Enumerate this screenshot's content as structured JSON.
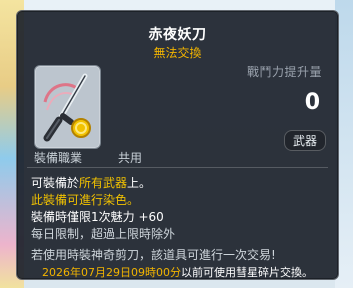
{
  "tooltip": {
    "title": "赤夜妖刀",
    "subtitle": "無法交換",
    "power_label": "戰鬥力提升量",
    "power_value": "0",
    "category": "武器",
    "job_label": "裝備職業",
    "job_value": "共用",
    "desc": {
      "line1_prefix": "可裝備於",
      "line1_highlight": "所有武器",
      "line1_suffix": "上。",
      "line2": "此裝備可進行染色。",
      "line3": "裝備時僅限1次魅力 +60",
      "line4": "每日限制，超過上限時除外",
      "line5": "若使用時裝神奇剪刀，該道具可進行一次交易!"
    },
    "footer": {
      "date": "2026年07月29日09時00分",
      "suffix": "以前可使用彗星碎片交換。"
    }
  },
  "icons": {
    "item_icon": "katana-icon"
  },
  "colors": {
    "accent_yellow": "#f2b400",
    "panel_bg": "#1c222b"
  }
}
